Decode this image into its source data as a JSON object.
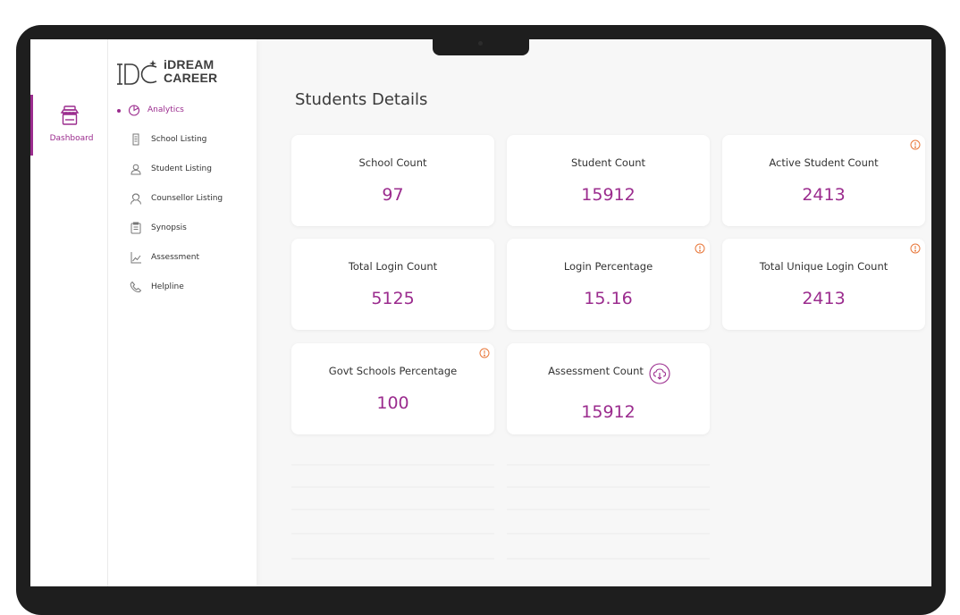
{
  "rail": {
    "dashboard_label": "Dashboard"
  },
  "brand": {
    "line1": "iDREAM",
    "line2": "CAREER"
  },
  "nav": {
    "items": [
      {
        "label": "Analytics",
        "icon": "analytics-icon",
        "active": true
      },
      {
        "label": "School Listing",
        "icon": "school-icon"
      },
      {
        "label": "Student Listing",
        "icon": "student-icon"
      },
      {
        "label": "Counsellor Listing",
        "icon": "counsellor-icon"
      },
      {
        "label": "Synopsis",
        "icon": "synopsis-icon"
      },
      {
        "label": "Assessment",
        "icon": "assessment-icon"
      },
      {
        "label": "Helpline",
        "icon": "phone-icon"
      }
    ]
  },
  "main": {
    "title": "Students Details",
    "cards": [
      {
        "label": "School Count",
        "value": "97"
      },
      {
        "label": "Student Count",
        "value": "15912"
      },
      {
        "label": "Active Student Count",
        "value": "2413",
        "info": true
      },
      {
        "label": "Total Login Count",
        "value": "5125"
      },
      {
        "label": "Login Percentage",
        "value": "15.16",
        "info": true
      },
      {
        "label": "Total Unique Login Count",
        "value": "2413",
        "info": true
      },
      {
        "label": "Govt Schools Percentage",
        "value": "100",
        "info": true
      },
      {
        "label": "Assessment Count",
        "value": "15912",
        "download": true
      }
    ]
  },
  "colors": {
    "accent": "#9b2c8e",
    "info": "#e8773a",
    "text": "#333333"
  }
}
